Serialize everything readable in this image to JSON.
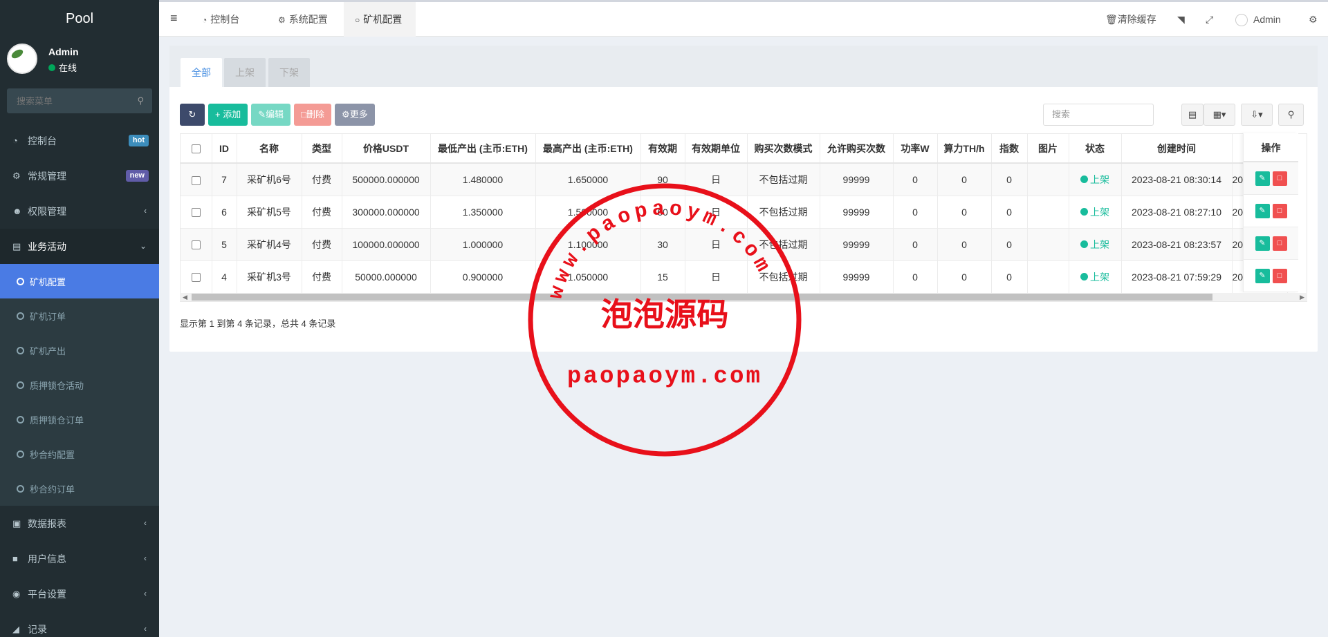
{
  "sidebar": {
    "logo": "Pool",
    "user": {
      "name": "Admin",
      "status": "在线"
    },
    "search_placeholder": "搜索菜单",
    "items": [
      {
        "label": "控制台",
        "badge": "hot"
      },
      {
        "label": "常规管理",
        "badge": "new"
      },
      {
        "label": "权限管理"
      },
      {
        "label": "业务活动"
      }
    ],
    "submenu": [
      {
        "label": "矿机配置"
      },
      {
        "label": "矿机订单"
      },
      {
        "label": "矿机产出"
      },
      {
        "label": "质押锁仓活动"
      },
      {
        "label": "质押锁仓订单"
      },
      {
        "label": "秒合约配置"
      },
      {
        "label": "秒合约订单"
      }
    ],
    "bottom_items": [
      {
        "label": "数据报表"
      },
      {
        "label": "用户信息"
      },
      {
        "label": "平台设置"
      },
      {
        "label": "记录"
      }
    ]
  },
  "header": {
    "tabs": [
      {
        "label": "控制台"
      },
      {
        "label": "系统配置"
      },
      {
        "label": "矿机配置"
      }
    ],
    "clear_cache": "清除缓存",
    "admin": "Admin"
  },
  "panel": {
    "tabs": [
      {
        "label": "全部"
      },
      {
        "label": "上架"
      },
      {
        "label": "下架"
      }
    ],
    "buttons": {
      "add": "添加",
      "edit": "编辑",
      "delete": "删除",
      "more": "更多"
    },
    "search_placeholder": "搜索",
    "columns": [
      "ID",
      "名称",
      "类型",
      "价格USDT",
      "最低产出 (主币:ETH)",
      "最高产出 (主币:ETH)",
      "有效期",
      "有效期单位",
      "购买次数模式",
      "允许购买次数",
      "功率W",
      "算力TH/h",
      "指数",
      "图片",
      "状态",
      "创建时间",
      "",
      "操作"
    ],
    "rows": [
      [
        "7",
        "采矿机6号",
        "付费",
        "500000.000000",
        "1.480000",
        "1.650000",
        "90",
        "日",
        "不包括过期",
        "99999",
        "0",
        "0",
        "0",
        "",
        "上架",
        "2023-08-21 08:30:14",
        "20"
      ],
      [
        "6",
        "采矿机5号",
        "付费",
        "300000.000000",
        "1.350000",
        "1.500000",
        "60",
        "日",
        "不包括过期",
        "99999",
        "0",
        "0",
        "0",
        "",
        "上架",
        "2023-08-21 08:27:10",
        "20"
      ],
      [
        "5",
        "采矿机4号",
        "付费",
        "100000.000000",
        "1.000000",
        "1.100000",
        "30",
        "日",
        "不包括过期",
        "99999",
        "0",
        "0",
        "0",
        "",
        "上架",
        "2023-08-21 08:23:57",
        "20"
      ],
      [
        "4",
        "采矿机3号",
        "付费",
        "50000.000000",
        "0.900000",
        "1.050000",
        "15",
        "日",
        "不包括过期",
        "99999",
        "0",
        "0",
        "0",
        "",
        "上架",
        "2023-08-21 07:59:29",
        "20"
      ]
    ],
    "page_info": "显示第 1 到第 4 条记录，总共 4 条记录"
  },
  "watermark": {
    "ring_text": "www.paopaoym.com",
    "title": "泡泡源码",
    "domain": "paopaoym.com",
    "color": "#e8101a"
  }
}
